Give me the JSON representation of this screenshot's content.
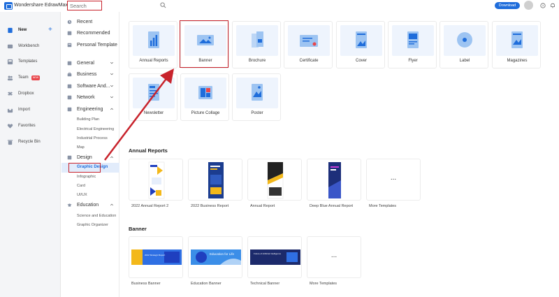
{
  "topbar": {
    "app_title": "Wondershare EdrawMax",
    "search_placeholder": "Search",
    "download_label": "Download"
  },
  "leftnav": {
    "items": [
      {
        "label": "New",
        "icon": "new-file-icon"
      },
      {
        "label": "Workbench",
        "icon": "workbench-icon"
      },
      {
        "label": "Templates",
        "icon": "templates-icon"
      },
      {
        "label": "Team",
        "icon": "team-icon",
        "badge": "NEW"
      },
      {
        "label": "Dropbox",
        "icon": "dropbox-icon"
      },
      {
        "label": "Import",
        "icon": "import-icon"
      },
      {
        "label": "Favorites",
        "icon": "heart-icon"
      },
      {
        "label": "Recycle Bin",
        "icon": "trash-icon"
      }
    ]
  },
  "catnav": {
    "top": [
      "Recent",
      "Recommended",
      "Personal Template"
    ],
    "groups": [
      "General",
      "Business",
      "Software And...",
      "Network",
      "Engineering"
    ],
    "engineering_sub": [
      "Building Plan",
      "Electrical Engineering",
      "Industrial Process",
      "Map"
    ],
    "design": "Design",
    "design_sub": [
      "Graphic Design",
      "Infographic",
      "Card",
      "UI/UX"
    ],
    "education": "Education",
    "education_sub": [
      "Science and Education",
      "Graphic Organizer"
    ]
  },
  "types": [
    "Annual Reports",
    "Banner",
    "Brochure",
    "Certificate",
    "Cover",
    "Flyer",
    "Label",
    "Magazines",
    "Newsletter",
    "Picture Collage",
    "Poster"
  ],
  "annual_reports": {
    "title": "Annual Reports",
    "items": [
      "2022 Annual Report 2",
      "2022 Business Report",
      "Annual Report",
      "Deep Blue Annual Report",
      "More Templates"
    ]
  },
  "banner": {
    "title": "Banner",
    "items": [
      "Business Banner",
      "Education Banner",
      "Technical Banner",
      "More Templates"
    ],
    "thumb_texts": [
      "2022 Strategic Report",
      "Education for Life",
      "Future of Artificial Intelligence"
    ]
  },
  "more_symbol": "...",
  "colors": {
    "accent": "#1f6ddb",
    "highlight": "#c8232c",
    "selected_bg": "#e2ecfb"
  }
}
